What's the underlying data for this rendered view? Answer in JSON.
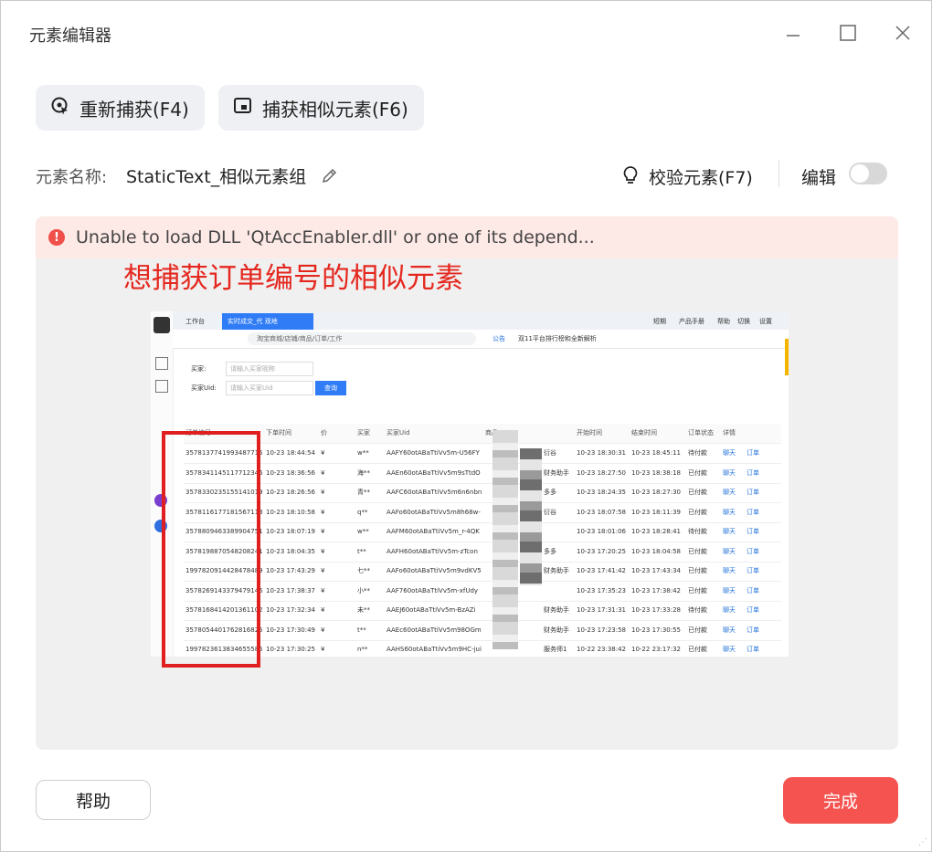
{
  "window": {
    "title": "元素编辑器",
    "icons": {
      "minimize": "minimize-icon",
      "maximize": "maximize-icon",
      "close": "close-icon"
    }
  },
  "toolbar": {
    "recapture_label": "重新捕获(F4)",
    "capture_similar_label": "捕获相似元素(F6)"
  },
  "element": {
    "name_label": "元素名称:",
    "name_value": "StaticText_相似元素组",
    "validate_label": "校验元素(F7)",
    "edit_label": "编辑",
    "edit_toggle_on": false
  },
  "error": {
    "message": "Unable to load DLL 'QtAccEnabler.dll' or one of its depend...",
    "icon_text": "!"
  },
  "preview": {
    "annotation": "想捕获订单编号的相似元素",
    "tabs": [
      "工作台",
      "实时成交_代 观地"
    ],
    "top_links": [
      "短期",
      "产品手册",
      "帮助",
      "切换",
      "设置"
    ],
    "address_text": "淘宝商城/店铺/商品/订单/工作",
    "notice_label": "公告",
    "notice_text": "双11平台排行榜和全新解析",
    "filter_buyer_label": "买家:",
    "filter_buyer_placeholder": "请输入买家昵称",
    "filter_uid_label": "买家Uid:",
    "filter_uid_placeholder": "请输入买家Uid",
    "query_button": "查询",
    "headers": [
      "订单编号",
      "下单时间",
      "价",
      "买家",
      "买家Uid",
      "商品",
      "",
      "开始时间",
      "结束时间",
      "订单状态",
      "详情"
    ],
    "rows": [
      {
        "id": "3578137741993487715",
        "time": "10-23 18:44:54",
        "price": "¥",
        "buyer": "w**",
        "uid": "AAFY60otABaTtiVv5m-U56FY",
        "sel": "衍谷",
        "start": "10-23 18:30:31",
        "end": "10-23 18:45:11",
        "status": "待付款",
        "a": "聊天",
        "b": "订单"
      },
      {
        "id": "3578341145117712346",
        "time": "10-23 18:36:56",
        "price": "¥",
        "buyer": "海**",
        "uid": "AAEn60otABaTtiVv5m9sTtdO",
        "sel": "财务助手",
        "start": "10-23 18:27:50",
        "end": "10-23 18:38:18",
        "status": "已付款",
        "a": "聊天",
        "b": "订单"
      },
      {
        "id": "3578330235155141019",
        "time": "10-23 18:26:56",
        "price": "¥",
        "buyer": "青**",
        "uid": "AAFC60otABaTtiVv5m6n6nbn",
        "sel": "多多",
        "start": "10-23 18:24:35",
        "end": "10-23 18:27:30",
        "status": "已付款",
        "a": "聊天",
        "b": "订单"
      },
      {
        "id": "3578116177181567118",
        "time": "10-23 18:10:58",
        "price": "¥",
        "buyer": "q**",
        "uid": "AAFo60otABaTtiVv5m8h68w-",
        "sel": "衍谷",
        "start": "10-23 18:07:58",
        "end": "10-23 18:11:39",
        "status": "已付款",
        "a": "聊天",
        "b": "订单"
      },
      {
        "id": "3578809463389904751",
        "time": "10-23 18:07:19",
        "price": "¥",
        "buyer": "w**",
        "uid": "AAFM60otABaTtiVv5m_r-4QK",
        "sel": "",
        "start": "10-23 18:01:06",
        "end": "10-23 18:28:41",
        "status": "待付款",
        "a": "聊天",
        "b": "订单"
      },
      {
        "id": "3578198870548208241",
        "time": "10-23 18:04:35",
        "price": "¥",
        "buyer": "t**",
        "uid": "AAFH60otABaTtiVv5m-zTcon",
        "sel": "多多",
        "start": "10-23 17:20:25",
        "end": "10-23 18:04:58",
        "status": "已付款",
        "a": "聊天",
        "b": "订单"
      },
      {
        "id": "1997820914428478489",
        "time": "10-23 17:43:29",
        "price": "¥",
        "buyer": "七**",
        "uid": "AAFo60otABaTtiVv5m9vdKV5",
        "sel": "财务助手",
        "start": "10-23 17:41:42",
        "end": "10-23 17:43:34",
        "status": "已付款",
        "a": "聊天",
        "b": "订单"
      },
      {
        "id": "3578269143379479146",
        "time": "10-23 17:38:37",
        "price": "¥",
        "buyer": "小**",
        "uid": "AAF760otABaTtiVv5m-xfUdy",
        "sel": "",
        "start": "10-23 17:35:23",
        "end": "10-23 17:38:42",
        "status": "已付款",
        "a": "聊天",
        "b": "订单"
      },
      {
        "id": "3578168414201361102",
        "time": "10-23 17:32:34",
        "price": "¥",
        "buyer": "未**",
        "uid": "AAEJ60otABaTtiVv5m-BzAZi",
        "sel": "财务助手",
        "start": "10-23 17:31:31",
        "end": "10-23 17:33:28",
        "status": "待付款",
        "a": "聊天",
        "b": "订单"
      },
      {
        "id": "3578054401762816825",
        "time": "10-23 17:30:49",
        "price": "¥",
        "buyer": "t**",
        "uid": "AAEc60otABaTtiVv5m98OGmp",
        "sel": "财务助手",
        "start": "10-23 17:23:58",
        "end": "10-23 17:30:55",
        "status": "已付款",
        "a": "聊天",
        "b": "订单"
      },
      {
        "id": "1997823613834655585",
        "time": "10-23 17:30:25",
        "price": "¥",
        "buyer": "n**",
        "uid": "AAHS60otABaTtiVv5m9HC-jui",
        "sel": "服务师1",
        "start": "10-22 23:38:42",
        "end": "10-22 23:17:32",
        "status": "已付款",
        "a": "聊天",
        "b": "订单"
      }
    ]
  },
  "footer": {
    "help_label": "帮助",
    "done_label": "完成"
  },
  "colors": {
    "accent": "#f5534f",
    "error_bg": "#fde9e6",
    "annotation": "#e5281f",
    "link": "#1e6fd9"
  }
}
